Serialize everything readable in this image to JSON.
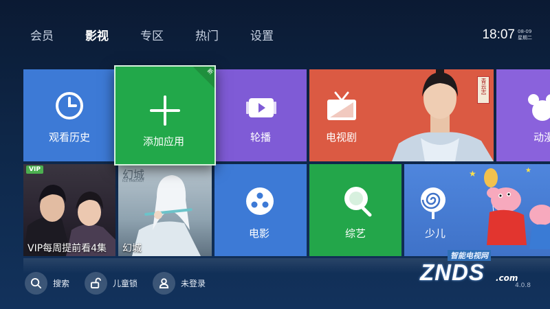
{
  "nav": {
    "items": [
      {
        "label": "会员",
        "active": false
      },
      {
        "label": "影视",
        "active": true
      },
      {
        "label": "专区",
        "active": false
      },
      {
        "label": "热门",
        "active": false
      },
      {
        "label": "设置",
        "active": false
      }
    ]
  },
  "clock": {
    "time": "18:07",
    "date": "08-09",
    "weekday": "星期二"
  },
  "tiles": {
    "history": {
      "label": "观看历史",
      "icon": "clock-icon"
    },
    "add_app": {
      "label": "添加应用",
      "icon": "plus-icon",
      "badge": "新"
    },
    "carousel": {
      "label": "轮播",
      "icon": "play-icon"
    },
    "drama": {
      "label": "电视剧",
      "icon": "tv-icon",
      "poster_seal": "青云志"
    },
    "animation": {
      "label": "动漫",
      "icon": "mickey-icon"
    },
    "vip": {
      "label": "VIP每周提前看4集",
      "badge": "VIP"
    },
    "huancheng": {
      "label": "幻城",
      "poster_title": "幻城",
      "poster_sub": "ICE FANTASY"
    },
    "movie": {
      "label": "电影",
      "icon": "film-reel-icon"
    },
    "variety": {
      "label": "综艺",
      "icon": "microphone-icon"
    },
    "kids": {
      "label": "少儿",
      "icon": "lollipop-icon"
    }
  },
  "bottom": {
    "search": "搜索",
    "child_lock": "儿童锁",
    "login": "未登录"
  },
  "watermark": {
    "top": "智能电视网",
    "main": "ZNDS",
    "suffix": ".com"
  },
  "version": "4.0.8",
  "colors": {
    "blue_tile": "#3d7ad6",
    "green_tile": "#22a84a",
    "purple_tile": "#7f5bd6",
    "red_tile": "#db5a43"
  }
}
